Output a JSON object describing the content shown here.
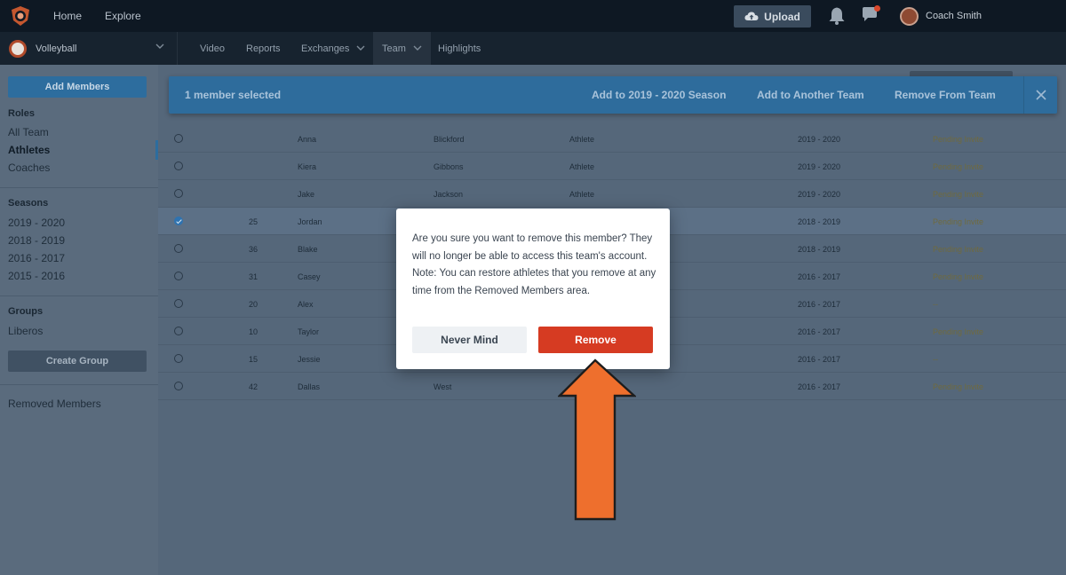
{
  "colors": {
    "accent": "#2e6c9c",
    "danger": "#d63b22",
    "annotation_arrow": "#ee6f2d",
    "topbar": "#0e1823"
  },
  "topnav": {
    "links": [
      "Home",
      "Explore"
    ],
    "upload_label": "Upload",
    "user_name": "Coach Smith",
    "icons": [
      "logo-icon",
      "cloud-upload-icon",
      "bell-icon",
      "chat-icon"
    ]
  },
  "subnav": {
    "team_name": "Volleyball",
    "items": [
      "Video",
      "Reports",
      "Exchanges",
      "Team",
      "Highlights"
    ],
    "active_item": "Team"
  },
  "sidebar": {
    "add_members_label": "Add Members",
    "roles_heading": "Roles",
    "roles": [
      "All Team",
      "Athletes",
      "Coaches"
    ],
    "active_role": "Athletes",
    "seasons_heading": "Seasons",
    "seasons": [
      "2019 - 2020",
      "2018 - 2019",
      "2016 - 2017",
      "2015 - 2016"
    ],
    "groups_heading": "Groups",
    "groups": [
      "Liberos"
    ],
    "create_group_label": "Create Group",
    "removed_members_label": "Removed Members"
  },
  "banner": {
    "selected_text": "1 member selected",
    "action_add_season": "Add to 2019 - 2020 Season",
    "action_add_team": "Add to Another Team",
    "action_remove": "Remove From Team"
  },
  "table": {
    "rows": [
      {
        "number": "",
        "first": "Anna",
        "last": "Blickford",
        "role": "Athlete",
        "season": "2019 - 2020",
        "status": "Pending Invite",
        "checked": false
      },
      {
        "number": "",
        "first": "Kiera",
        "last": "Gibbons",
        "role": "Athlete",
        "season": "2019 - 2020",
        "status": "Pending Invite",
        "checked": false
      },
      {
        "number": "",
        "first": "Jake",
        "last": "Jackson",
        "role": "Athlete",
        "season": "2019 - 2020",
        "status": "Pending Invite",
        "checked": false
      },
      {
        "number": "25",
        "first": "Jordan",
        "last": "",
        "role": "",
        "season": "2018 - 2019",
        "status": "Pending Invite",
        "checked": true
      },
      {
        "number": "36",
        "first": "Blake",
        "last": "",
        "role": "",
        "season": "2018 - 2019",
        "status": "Pending Invite",
        "checked": false
      },
      {
        "number": "31",
        "first": "Casey",
        "last": "",
        "role": "",
        "season": "2016 - 2017",
        "status": "Pending Invite",
        "checked": false
      },
      {
        "number": "20",
        "first": "Alex",
        "last": "",
        "role": "",
        "season": "2016 - 2017",
        "status": "--",
        "checked": false
      },
      {
        "number": "10",
        "first": "Taylor",
        "last": "",
        "role": "",
        "season": "2016 - 2017",
        "status": "Pending Invite",
        "checked": false
      },
      {
        "number": "15",
        "first": "Jessie",
        "last": "",
        "role": "",
        "season": "2016 - 2017",
        "status": "--",
        "checked": false
      },
      {
        "number": "42",
        "first": "Dallas",
        "last": "West",
        "role": "",
        "season": "2016 - 2017",
        "status": "Pending Invite",
        "checked": false
      }
    ]
  },
  "modal": {
    "message": "Are you sure you want to remove this member? They will no longer be able to access this team's account. Note: You can restore athletes that you remove at any time from the Removed Members area.",
    "cancel_label": "Never Mind",
    "confirm_label": "Remove"
  }
}
